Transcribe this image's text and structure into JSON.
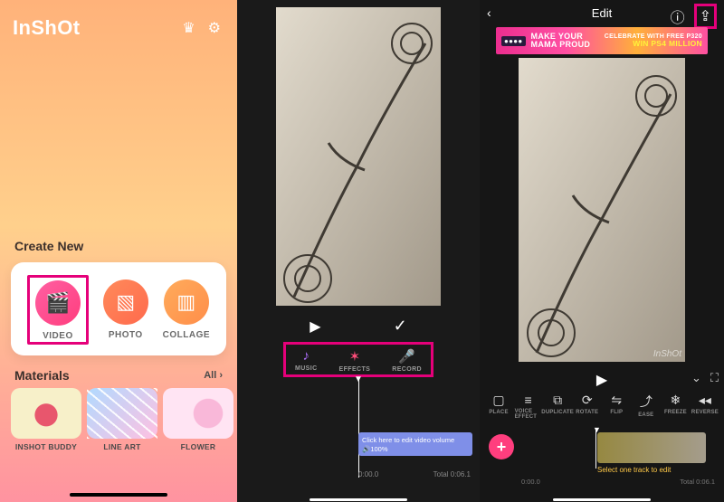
{
  "home": {
    "logo": "InShOt",
    "section_create": "Create New",
    "create": {
      "video": "VIDEO",
      "photo": "PHOTO",
      "collage": "COLLAGE"
    },
    "section_materials": "Materials",
    "materials_all": "All ›",
    "materials": [
      {
        "label": "INSHOT BUDDY"
      },
      {
        "label": "LINE ART"
      },
      {
        "label": "FLOWER"
      }
    ]
  },
  "edit1": {
    "audio": {
      "music": "MUSIC",
      "effects": "EFFECTS",
      "record": "RECORD"
    },
    "timeline": {
      "hint": "Click here to edit video volume",
      "volume": "🔊100%",
      "time": "0:00.0",
      "total": "Total 0:06.1"
    }
  },
  "edit2": {
    "title": "Edit",
    "ad": {
      "line1": "MAKE YOUR",
      "line2": "MAMA PROUD",
      "right1": "CELEBRATE WITH FREE P320",
      "right2": "WIN PS4 MILLION"
    },
    "brand": "InShOt",
    "tools": [
      {
        "label": "PLACE"
      },
      {
        "label": "VOICE EFFECT"
      },
      {
        "label": "DUPLICATE"
      },
      {
        "label": "ROTATE"
      },
      {
        "label": "FLIP"
      },
      {
        "label": "EASE"
      },
      {
        "label": "FREEZE"
      },
      {
        "label": "REVERSE"
      }
    ],
    "hint": "Select one track to edit",
    "time": "0:00.0",
    "total": "Total 0:06.1"
  }
}
